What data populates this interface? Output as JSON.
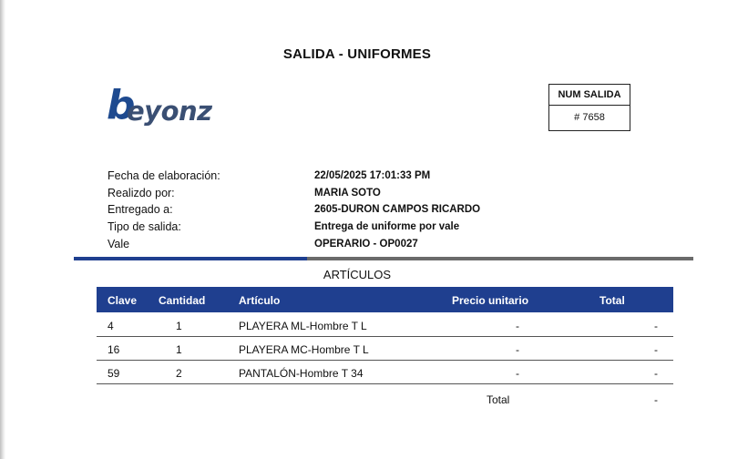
{
  "document": {
    "title": "SALIDA - UNIFORMES",
    "logo_text": {
      "initial": "b",
      "rest": "eyonz"
    }
  },
  "num_salida": {
    "label": "NUM SALIDA",
    "value": "# 7658"
  },
  "info": [
    {
      "label": "Fecha de elaboración:",
      "value": "22/05/2025 17:01:33 PM"
    },
    {
      "label": "Realizdo por:",
      "value": "MARIA SOTO"
    },
    {
      "label": "Entregado a:",
      "value": "2605-DURON CAMPOS RICARDO"
    },
    {
      "label": "Tipo de salida:",
      "value": "Entrega de uniforme por vale"
    },
    {
      "label": "Vale",
      "value": "OPERARIO - OP0027"
    }
  ],
  "articles": {
    "section_title": "ARTÍCULOS",
    "headers": [
      "Clave",
      "Cantidad",
      "Artículo",
      "Precio unitario",
      "Total"
    ],
    "rows": [
      {
        "clave": "4",
        "cantidad": "1",
        "articulo": "PLAYERA ML-Hombre T L",
        "precio": "-",
        "total": "-"
      },
      {
        "clave": "16",
        "cantidad": "1",
        "articulo": "PLAYERA MC-Hombre T L",
        "precio": "-",
        "total": "-"
      },
      {
        "clave": "59",
        "cantidad": "2",
        "articulo": "PANTALÓN-Hombre T 34",
        "precio": "-",
        "total": "-"
      }
    ],
    "total_label": "Total",
    "total_value": "-"
  },
  "colors": {
    "brand_blue": "#1f3f8f",
    "divider_gray": "#6b6b6b"
  }
}
